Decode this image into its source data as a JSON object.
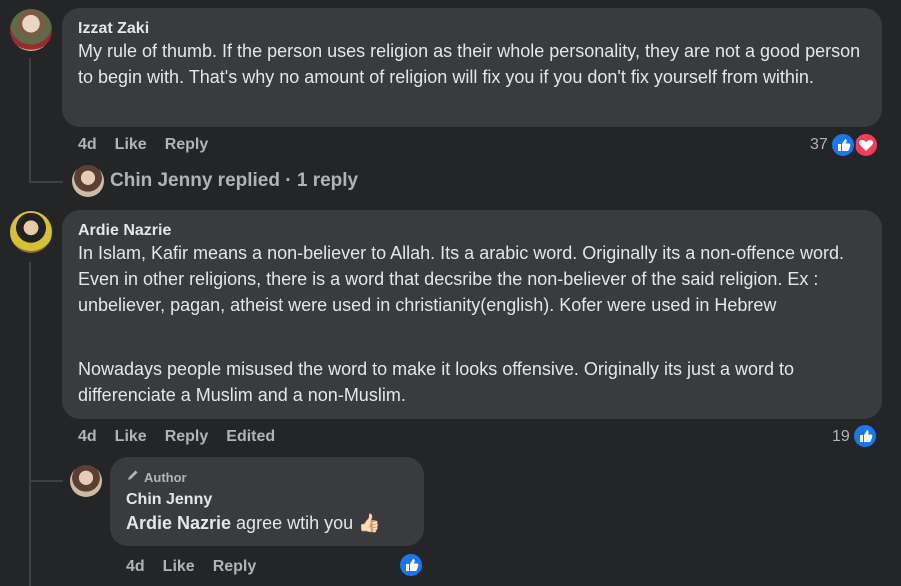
{
  "comments": [
    {
      "author": "Izzat Zaki",
      "text": "My rule of thumb. If the person uses religion as their whole personality, they are not a good person to begin with. That's why no amount of religion will fix you if you don't fix yourself from within.",
      "time": "4d",
      "like_label": "Like",
      "reply_label": "Reply",
      "reaction_count": "37",
      "reactions": [
        "like-icon",
        "love-icon"
      ],
      "replies_summary": {
        "text": "Chin Jenny replied · 1 reply"
      }
    },
    {
      "author": "Ardie Nazrie",
      "paragraph1": "In Islam, Kafir means a non-believer to Allah. Its a arabic word. Originally its a non-offence word. Even in other religions, there is a word that decsribe the non-believer of the said religion. Ex : unbeliever, pagan, atheist were used in christianity(english). Kofer were used in Hebrew",
      "paragraph2": "Nowadays people misused the word to make it looks offensive. Originally its just a word to differenciate a Muslim and a non-Muslim.",
      "time": "4d",
      "like_label": "Like",
      "reply_label": "Reply",
      "edited_label": "Edited",
      "reaction_count": "19",
      "reactions": [
        "like-icon"
      ],
      "reply": {
        "badge": "Author",
        "author": "Chin Jenny",
        "mention": "Ardie Nazrie",
        "text": " agree wtih you ",
        "emoji": "👍🏻",
        "time": "4d",
        "like_label": "Like",
        "reply_label": "Reply",
        "reactions": [
          "like-icon"
        ]
      }
    }
  ],
  "colors": {
    "background": "#242526",
    "bubble": "#3a3b3c",
    "text": "#e4e6eb",
    "meta": "#b0b3b8",
    "like_blue": "#1877f2",
    "love_red": "#f33e58"
  }
}
